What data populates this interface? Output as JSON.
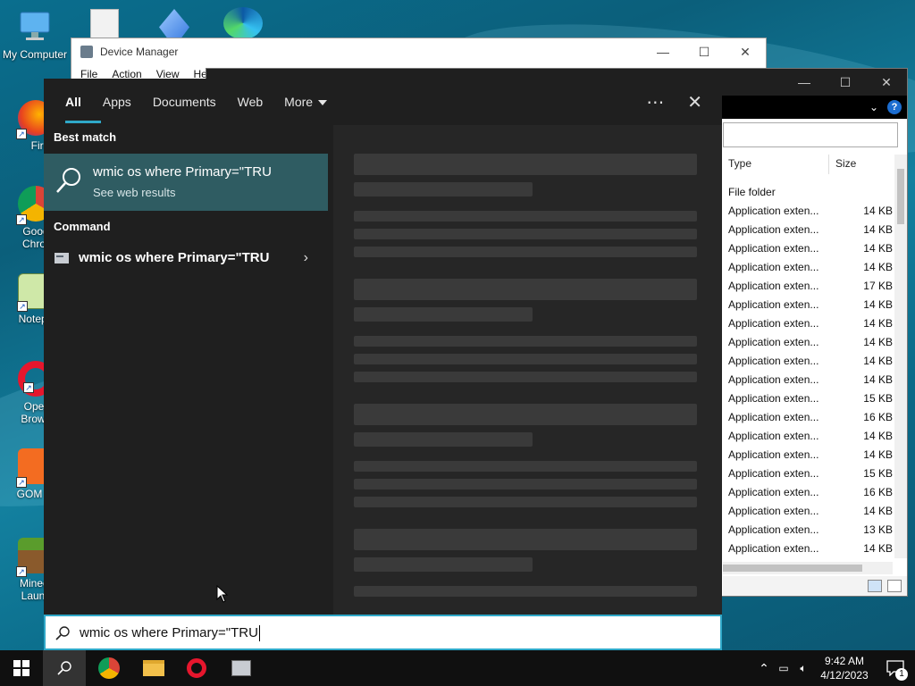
{
  "desktop": {
    "icons": [
      {
        "label": "My Computer"
      },
      {
        "label": "Firefo"
      },
      {
        "label": "Goog\nChror"
      },
      {
        "label": "Notepa"
      },
      {
        "label": "Oper\nBrows"
      },
      {
        "label": "GOM Pl"
      },
      {
        "label": "Minecr\nLaunc"
      }
    ]
  },
  "device_manager": {
    "title": "Device Manager",
    "menu": [
      "File",
      "Action",
      "View",
      "He"
    ]
  },
  "explorer": {
    "columns": {
      "type": "Type",
      "size": "Size"
    },
    "rows": [
      {
        "type": "File folder",
        "size": ""
      },
      {
        "type": "Application exten...",
        "size": "14 KB"
      },
      {
        "type": "Application exten...",
        "size": "14 KB"
      },
      {
        "type": "Application exten...",
        "size": "14 KB"
      },
      {
        "type": "Application exten...",
        "size": "14 KB"
      },
      {
        "type": "Application exten...",
        "size": "17 KB"
      },
      {
        "type": "Application exten...",
        "size": "14 KB"
      },
      {
        "type": "Application exten...",
        "size": "14 KB"
      },
      {
        "type": "Application exten...",
        "size": "14 KB"
      },
      {
        "type": "Application exten...",
        "size": "14 KB"
      },
      {
        "type": "Application exten...",
        "size": "14 KB"
      },
      {
        "type": "Application exten...",
        "size": "15 KB"
      },
      {
        "type": "Application exten...",
        "size": "16 KB"
      },
      {
        "type": "Application exten...",
        "size": "14 KB"
      },
      {
        "type": "Application exten...",
        "size": "14 KB"
      },
      {
        "type": "Application exten...",
        "size": "15 KB"
      },
      {
        "type": "Application exten...",
        "size": "16 KB"
      },
      {
        "type": "Application exten...",
        "size": "14 KB"
      },
      {
        "type": "Application exten...",
        "size": "13 KB"
      },
      {
        "type": "Application exten...",
        "size": "14 KB"
      }
    ]
  },
  "search": {
    "tabs": [
      "All",
      "Apps",
      "Documents",
      "Web",
      "More"
    ],
    "active_tab": "All",
    "more_icon": "ellipsis-icon",
    "close_icon": "close-icon",
    "best_match_heading": "Best match",
    "best_match": {
      "title": "wmic os where Primary=\"TRU",
      "subtitle": "See web results"
    },
    "command_heading": "Command",
    "command_item": {
      "title": "wmic os where Primary=\"TRU"
    },
    "query": "wmic os where Primary=\"TRU"
  },
  "taskbar": {
    "apps": [
      "start",
      "search",
      "chrome",
      "file-explorer",
      "opera",
      "device-manager"
    ],
    "time": "9:42 AM",
    "date": "4/12/2023",
    "notifications": "1"
  },
  "colors": {
    "accent": "#2fa8c8",
    "best_match_bg": "#2f5c62",
    "panel_bg": "#1f1f1f"
  }
}
